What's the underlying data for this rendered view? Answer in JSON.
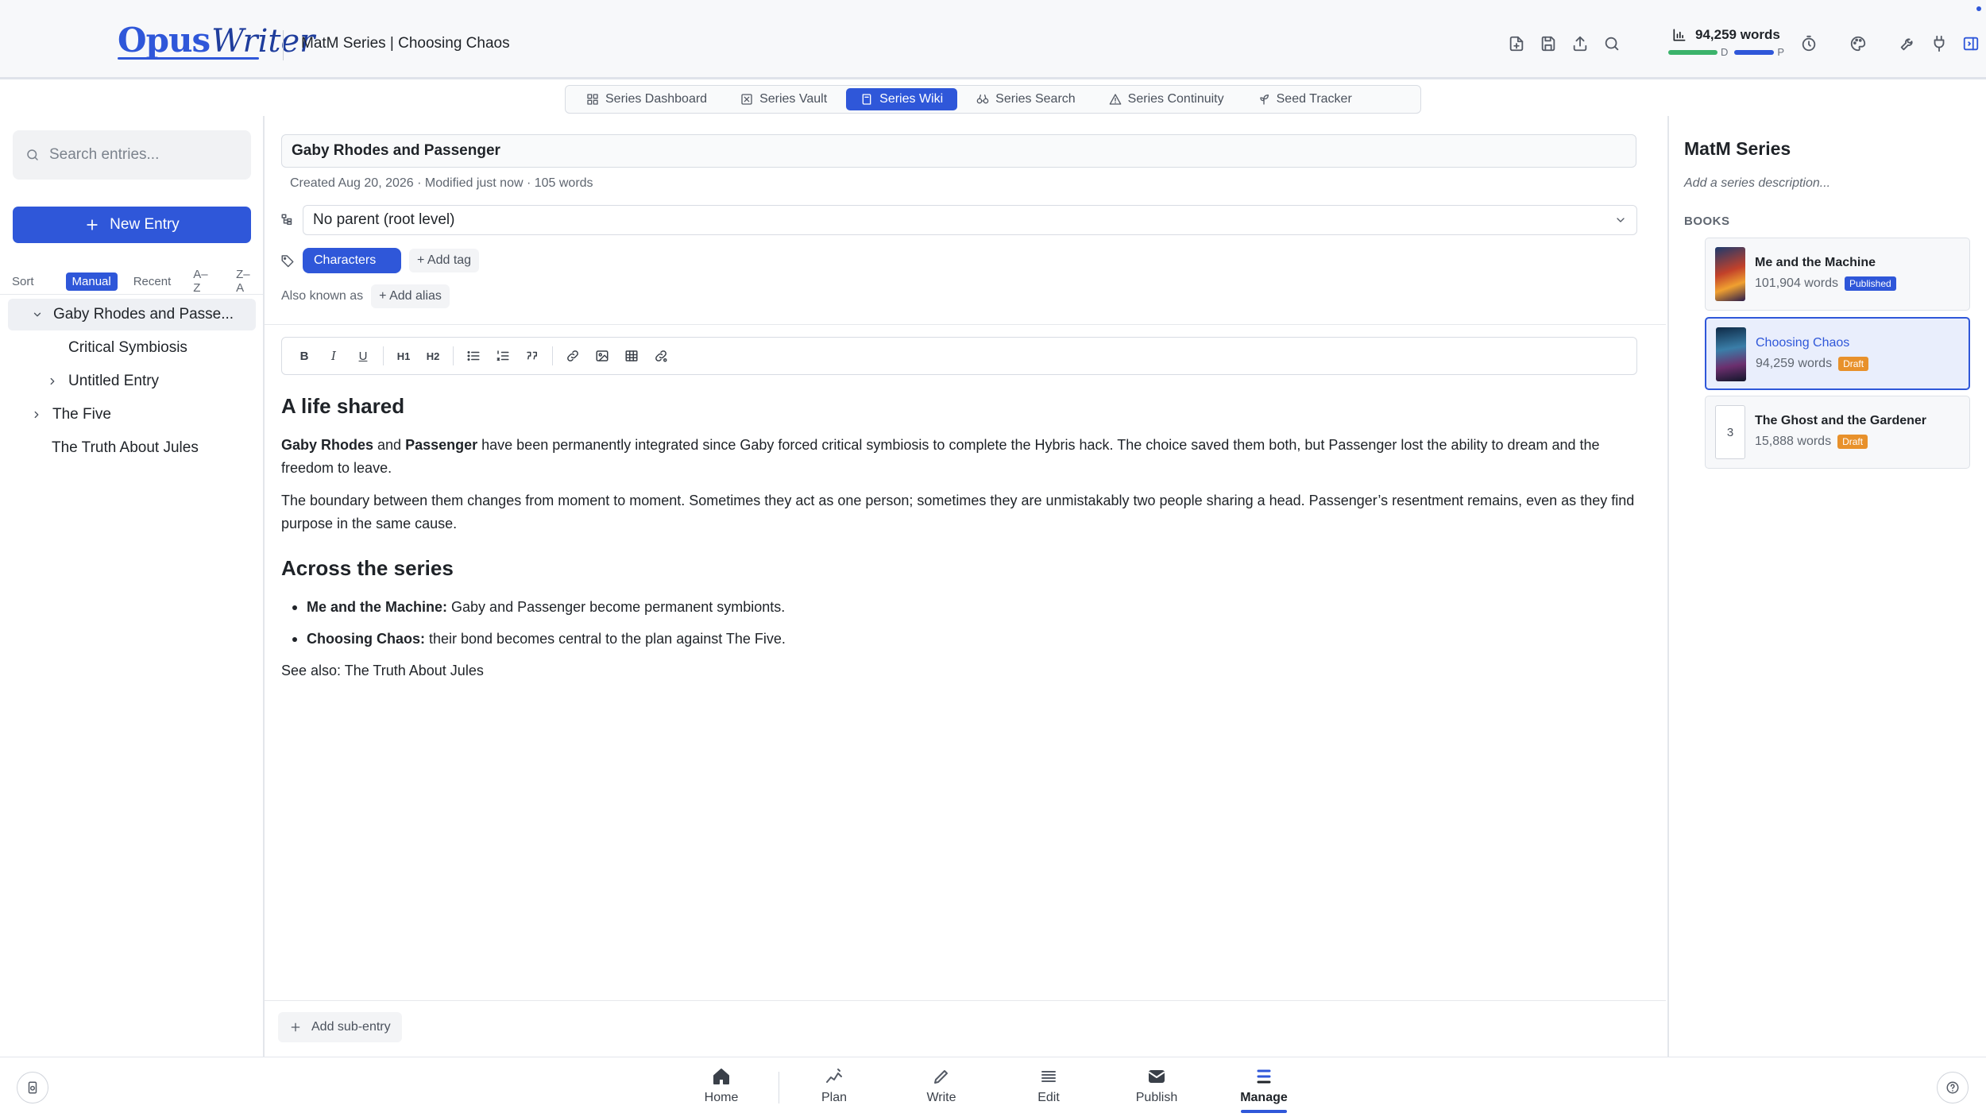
{
  "app": {
    "logo_primary": "Opus",
    "logo_secondary": "Writer",
    "project_title": "MatM Series | Choosing Chaos",
    "word_count": "94,259 words",
    "progress_draft_fraction": 1.0,
    "progress_publish_fraction": 0.82,
    "progress_labels": {
      "draft": "D",
      "publish": "P"
    },
    "header_icons": [
      "new-document-icon",
      "save-icon",
      "export-icon",
      "search-icon",
      "stats-icon",
      "timer-icon",
      "palette-icon",
      "wrench-icon",
      "plug-icon",
      "panel-toggle-icon"
    ]
  },
  "tabs": [
    {
      "label": "Series Dashboard",
      "icon": "grid-icon",
      "active": false
    },
    {
      "label": "Series Vault",
      "icon": "vault-icon",
      "active": false
    },
    {
      "label": "Series Wiki",
      "icon": "book-icon",
      "active": true
    },
    {
      "label": "Series Search",
      "icon": "binoculars-icon",
      "active": false
    },
    {
      "label": "Series Continuity",
      "icon": "warning-icon",
      "active": false
    },
    {
      "label": "Seed Tracker",
      "icon": "seedling-icon",
      "active": false
    }
  ],
  "sidebar": {
    "search_placeholder": "Search entries...",
    "new_entry_label": "New Entry",
    "sort_label": "Sort",
    "sort_options": [
      "Manual",
      "Recent",
      "A–Z",
      "Z–A"
    ],
    "sort_active": "Manual",
    "tree": [
      {
        "label": "Gaby Rhodes and Passe...",
        "depth": 0,
        "chevron": "down",
        "selected": true
      },
      {
        "label": "Critical Symbiosis",
        "depth": 1,
        "chevron": "none",
        "selected": false
      },
      {
        "label": "Untitled Entry",
        "depth": 1,
        "chevron": "right",
        "selected": false
      },
      {
        "label": "The Five",
        "depth": 0,
        "chevron": "right",
        "selected": false
      },
      {
        "label": "The Truth About Jules",
        "depth": 0,
        "chevron": "none",
        "selected": false
      }
    ]
  },
  "entry": {
    "title": "Gaby Rhodes and Passenger",
    "meta": "Created Aug 20, 2026 · Modified just now · 105 words",
    "parent": "No parent (root level)",
    "tag": "Characters",
    "add_tag_label": "+ Add tag",
    "alias_label": "Also known as",
    "add_alias_label": "+ Add alias",
    "toolbar": {
      "bold": "B",
      "italic": "I",
      "underline": "U",
      "h1": "H1",
      "h2": "H2"
    },
    "content": {
      "heading1": "A life shared",
      "p1_bold1": "Gaby Rhodes",
      "p1_and": " and ",
      "p1_bold2": "Passenger",
      "p1_rest": " have been permanently integrated since Gaby forced critical symbiosis to complete the Hybris hack. The choice saved them both, but Passenger lost the ability to dream and the freedom to leave.",
      "p2": "The boundary between them changes from moment to moment. Sometimes they act as one person; sometimes they are unmistakably two people sharing a head. Passenger’s resentment remains, even as they find purpose in the same cause.",
      "heading2": "Across the series",
      "bullets": [
        {
          "bold": "Me and the Machine:",
          "text": " Gaby and Passenger become permanent symbionts."
        },
        {
          "bold": "Choosing Chaos:",
          "text": " their bond becomes central to the plan against The Five."
        }
      ],
      "see_also": "See also: The Truth About Jules"
    },
    "add_sub_entry_label": "Add sub-entry"
  },
  "series_panel": {
    "name": "MatM Series",
    "description_placeholder": "Add a series description...",
    "books_label": "BOOKS",
    "books": [
      {
        "title": "Me and the Machine",
        "words": "101,904 words",
        "status": "Published",
        "status_color": "#2f57d9",
        "active": false,
        "cover": "cover-art",
        "number": ""
      },
      {
        "title": "Choosing Chaos",
        "words": "94,259 words",
        "status": "Draft",
        "status_color": "#e8912b",
        "active": true,
        "cover": "cover-art",
        "number": ""
      },
      {
        "title": "The Ghost and the Gardener",
        "words": "15,888 words",
        "status": "Draft",
        "status_color": "#e8912b",
        "active": false,
        "cover": "placeholder",
        "number": "3"
      }
    ]
  },
  "bottom_nav": [
    {
      "label": "Home",
      "icon": "home-icon",
      "active": false
    },
    {
      "label": "Plan",
      "icon": "plan-icon",
      "active": false
    },
    {
      "label": "Write",
      "icon": "pen-icon",
      "active": false
    },
    {
      "label": "Edit",
      "icon": "list-icon",
      "active": false
    },
    {
      "label": "Publish",
      "icon": "mail-icon",
      "active": false
    },
    {
      "label": "Manage",
      "icon": "stack-icon",
      "active": true
    }
  ],
  "colors": {
    "accent": "#2f57d9",
    "draft_badge": "#e8912b",
    "progress_green": "#3bb36b"
  }
}
